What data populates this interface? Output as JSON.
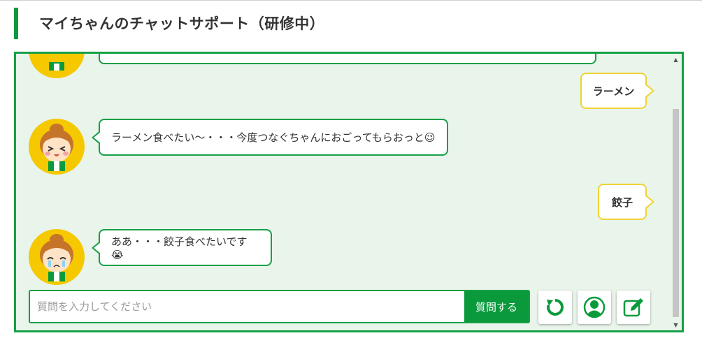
{
  "header": {
    "title": "マイちゃんのチャットサポート（研修中）"
  },
  "chat": {
    "messages": [
      {
        "from": "user",
        "text": "ラーメン"
      },
      {
        "from": "bot",
        "text": "ラーメン食べたい〜・・・今度つなぐちゃんにおごってもらおっと😉"
      },
      {
        "from": "user",
        "text": "餃子"
      },
      {
        "from": "bot",
        "text": "ああ・・・餃子食べたいです😭"
      }
    ]
  },
  "input": {
    "placeholder": "質問を入力してください",
    "value": ""
  },
  "buttons": {
    "send": "質問する",
    "reset_icon": "refresh-icon",
    "profile_icon": "user-circle-icon",
    "edit_icon": "edit-icon"
  },
  "colors": {
    "accent": "#0a9a3c",
    "panel_bg": "#e9f4ea",
    "user_border": "#f0d234"
  }
}
